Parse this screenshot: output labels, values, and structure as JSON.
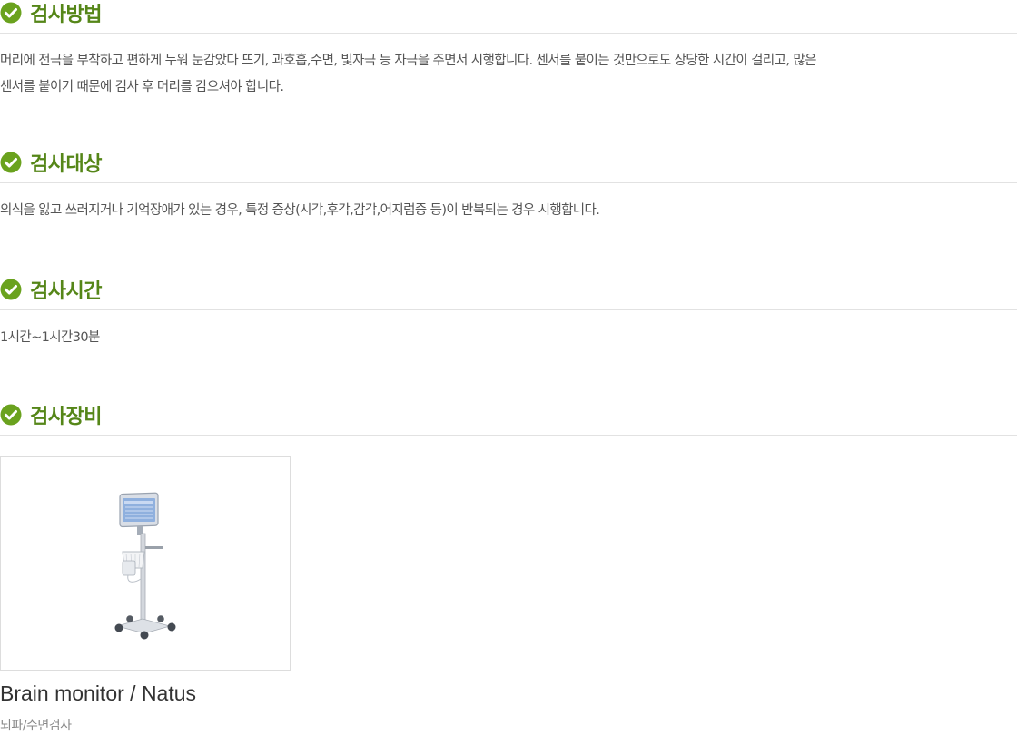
{
  "sections": [
    {
      "title": "검사방법",
      "lines": [
        "머리에 전극을 부착하고 편하게 누워 눈감았다 뜨기, 과호흡,수면, 빛자극 등 자극을 주면서 시행합니다. 센서를 붙이는 것만으로도 상당한 시간이 걸리고, 많은",
        "센서를 붙이기 때문에 검사 후 머리를 감으셔야 합니다."
      ]
    },
    {
      "title": "검사대상",
      "lines": [
        "의식을 잃고 쓰러지거나 기억장애가 있는 경우, 특정 증상(시각,후각,감각,어지럼증 등)이 반복되는 경우 시행합니다."
      ]
    },
    {
      "title": "검사시간",
      "lines": [
        "1시간~1시간30분"
      ]
    },
    {
      "title": "검사장비",
      "lines": []
    }
  ],
  "equipment": {
    "name": "Brain monitor / Natus",
    "type": "뇌파/수면검사",
    "image_icon": "brain-monitor-cart-image"
  },
  "colors": {
    "title_green": "#558618",
    "check_circle": "#6aa21e",
    "divider": "#e2e2e2",
    "body_text": "#555555"
  }
}
